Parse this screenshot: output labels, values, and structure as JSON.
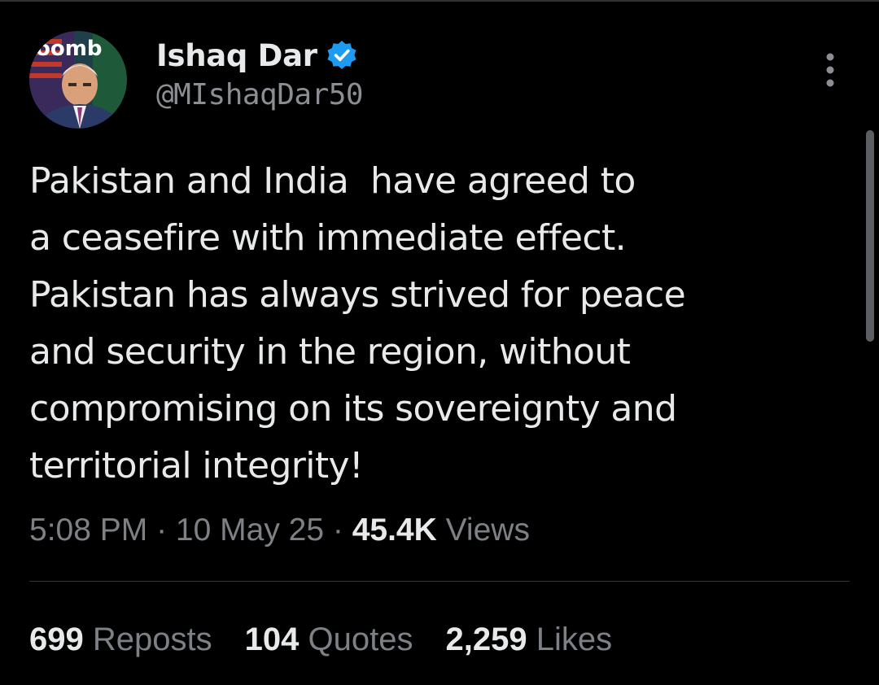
{
  "author": {
    "display_name": "Ishaq Dar",
    "handle": "@MIshaqDar50",
    "verified": true,
    "verified_color": "#1d9bf0",
    "avatar_icon": "profile-photo",
    "avatar_background_text": "oomb"
  },
  "more_icon": "more-vertical-icon",
  "tweet": {
    "lines": [
      "Pakistan and India  have agreed to",
      "a ceasefire with immediate effect.",
      "Pakistan has always strived for peace",
      "and security in the region, without",
      "compromising on its sovereignty and",
      "territorial integrity!"
    ]
  },
  "meta": {
    "time": "5:08 PM",
    "separator": " · ",
    "date": "10 May 25",
    "views_count": "45.4K",
    "views_label": "Views"
  },
  "stats": {
    "reposts_count": "699",
    "reposts_label": "Reposts",
    "quotes_count": "104",
    "quotes_label": "Quotes",
    "likes_count": "2,259",
    "likes_label": "Likes"
  },
  "colors": {
    "background": "#000000",
    "primary_text": "#e7e9ea",
    "secondary_text": "#7d8186",
    "divider": "#2f3336"
  }
}
